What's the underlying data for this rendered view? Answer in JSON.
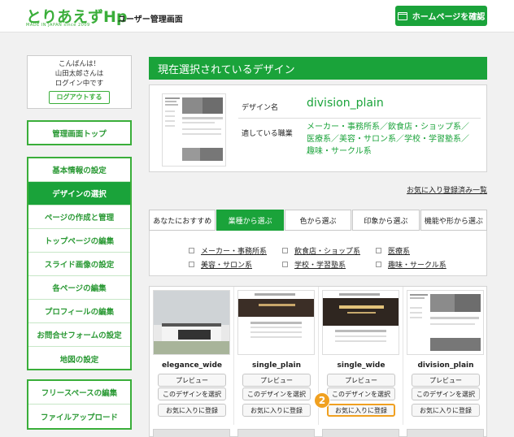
{
  "header": {
    "logo": "とりあえずHp",
    "logo_sub": "MADE IN JAPAN since 2009",
    "title": "ユーザー管理画面",
    "home_button": "ホームページを確認"
  },
  "sidebar": {
    "greeting": [
      "こんばんは！",
      "山田太郎さんは",
      "ログイン中です"
    ],
    "logout": "ログアウトする",
    "top_item": "管理画面トップ",
    "items": [
      {
        "label": "基本情報の設定"
      },
      {
        "label": "デザインの選択",
        "active": true
      },
      {
        "label": "ページの作成と管理"
      },
      {
        "label": "トップページの編集"
      },
      {
        "label": "スライド画像の設定"
      },
      {
        "label": "各ページの編集"
      },
      {
        "label": "プロフィールの編集"
      },
      {
        "label": "お問合せフォームの設定"
      },
      {
        "label": "地図の設定"
      }
    ],
    "bottom_items": [
      {
        "label": "フリースペースの編集"
      },
      {
        "label": "ファイルアップロード"
      }
    ]
  },
  "main": {
    "section_title": "現在選択されているデザイン",
    "current": {
      "name_label": "デザイン名",
      "name": "division_plain",
      "industry_label": "適している職業",
      "industries": "メーカー・事務所系／飲食店・ショップ系／医療系／美容・サロン系／学校・学習塾系／趣味・サークル系"
    },
    "favorites_link": "お気に入り登録済み一覧",
    "tabs": [
      {
        "label": "あなたにおすすめ"
      },
      {
        "label": "業種から選ぶ",
        "active": true
      },
      {
        "label": "色から選ぶ"
      },
      {
        "label": "印象から選ぶ"
      },
      {
        "label": "機能や形から選ぶ"
      }
    ],
    "filters": [
      "メーカー・事務所系",
      "飲食店・ショップ系",
      "医療系",
      "美容・サロン系",
      "学校・学習塾系",
      "趣味・サークル系"
    ],
    "designs": [
      {
        "name": "elegance_wide",
        "preview": "プレビュー",
        "select": "このデザインを選択",
        "favorite": "お気に入りに登録"
      },
      {
        "name": "single_plain",
        "preview": "プレビュー",
        "select": "このデザインを選択",
        "favorite": "お気に入りに登録"
      },
      {
        "name": "single_wide",
        "preview": "プレビュー",
        "select": "このデザインを選択",
        "favorite": "お気に入りに登録"
      },
      {
        "name": "division_plain",
        "preview": "プレビュー",
        "select": "このデザインを選択",
        "favorite": "お気に入りに登録"
      }
    ],
    "step_badge": "2"
  },
  "colors": {
    "brand_green": "#1aa33a",
    "highlight_orange": "#f0a020"
  }
}
